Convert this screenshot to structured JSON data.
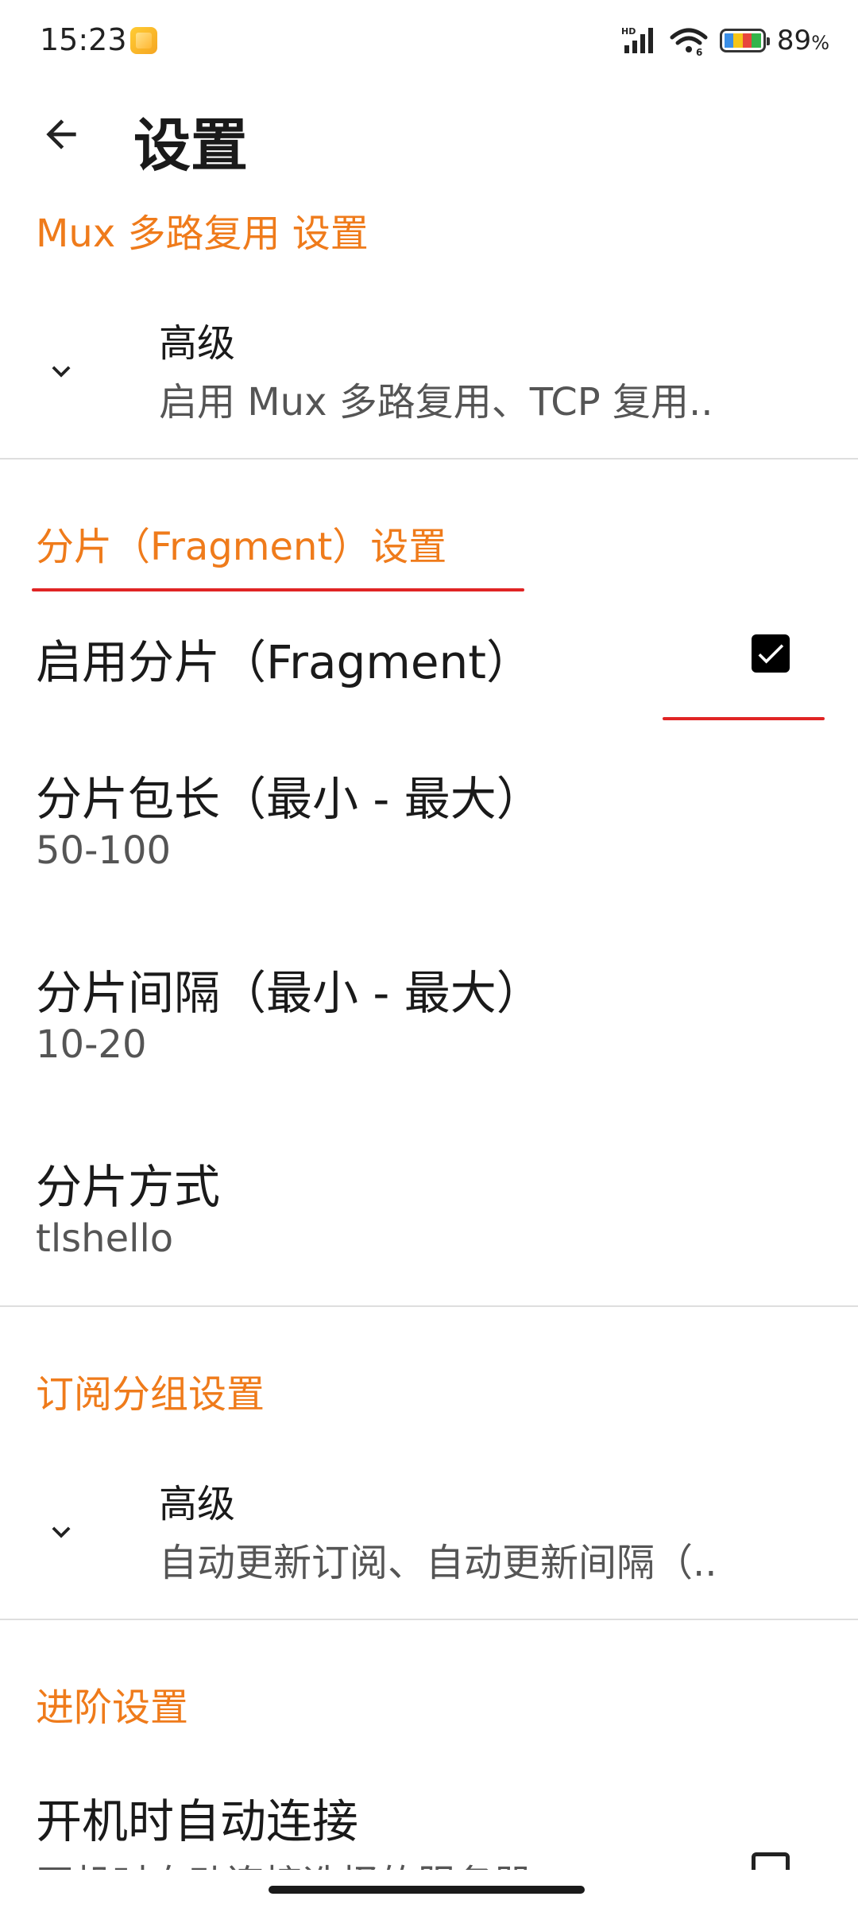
{
  "status_bar": {
    "time": "15:23",
    "notification_icon": "gallery-icon",
    "battery_percent": "89",
    "battery_unit": "%",
    "battery_level": 0.89,
    "battery_colors": [
      "#3a8ee6",
      "#f5c518",
      "#e8453c",
      "#34b44a"
    ]
  },
  "toolbar": {
    "title": "设置",
    "back_icon": "arrow-left-icon"
  },
  "sections": {
    "mux": {
      "header": "Mux 多路复用 设置",
      "advanced_title": "高级",
      "advanced_summary": "启用 Mux 多路复用、TCP 复用.."
    },
    "fragment": {
      "header": "分片（Fragment）设置",
      "enable_title": "启用分片（Fragment）",
      "enable_checked": true,
      "length_title": "分片包长（最小 - 最大）",
      "length_value": "50-100",
      "interval_title": "分片间隔（最小 - 最大）",
      "interval_value": "10-20",
      "method_title": "分片方式",
      "method_value": "tlshello"
    },
    "subscription": {
      "header": "订阅分组设置",
      "advanced_title": "高级",
      "advanced_summary": "自动更新订阅、自动更新间隔（.."
    },
    "advanced": {
      "header": "进阶设置",
      "autoconnect_title": "开机时自动连接",
      "autoconnect_summary": "开机时自动连接选择的服务器",
      "autoconnect_checked": false
    }
  },
  "colors": {
    "accent": "#ef7b1b",
    "annotation_red": "#e02424"
  }
}
